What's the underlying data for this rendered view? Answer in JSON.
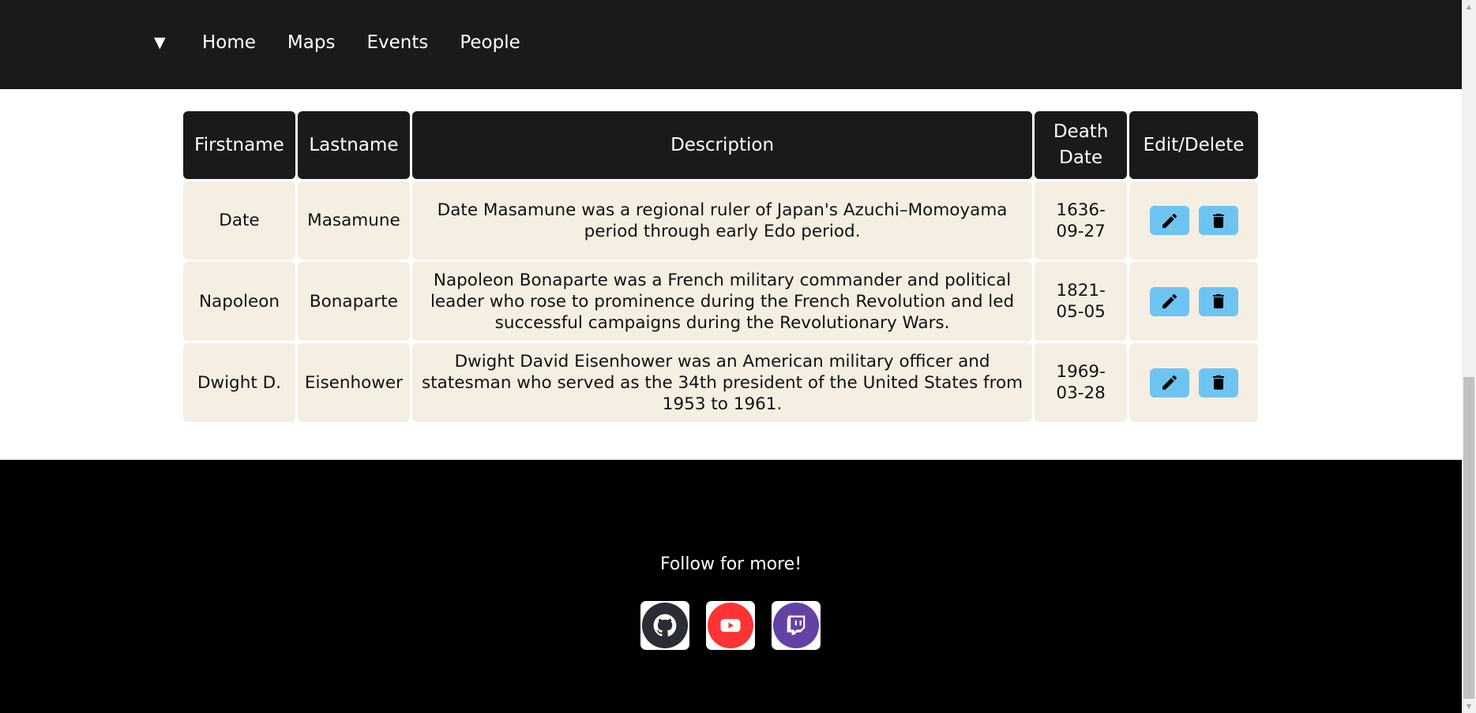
{
  "nav": {
    "toggle_glyph": "▼",
    "links": [
      "Home",
      "Maps",
      "Events",
      "People"
    ]
  },
  "table": {
    "headers": {
      "firstname": "Firstname",
      "lastname": "Lastname",
      "description": "Description",
      "death_date_line1": "Death",
      "death_date_line2": "Date",
      "actions": "Edit/Delete"
    },
    "rows": [
      {
        "firstname": "Date",
        "lastname": "Masamune",
        "description": "Date Masamune was a regional ruler of Japan's Azuchi–Momoyama period through early Edo period.",
        "death_date_1": "1636-",
        "death_date_2": "09-27"
      },
      {
        "firstname": "Napoleon",
        "lastname": "Bonaparte",
        "description": "Napoleon Bonaparte was a French military commander and political leader who rose to prominence during the French Revolution and led successful campaigns during the Revolutionary Wars.",
        "death_date_1": "1821-",
        "death_date_2": "05-05"
      },
      {
        "firstname": "Dwight D.",
        "lastname": "Eisenhower",
        "description": "Dwight David Eisenhower was an American military officer and statesman who served as the 34th president of the United States from 1953 to 1961.",
        "death_date_1": "1969-",
        "death_date_2": "03-28"
      }
    ]
  },
  "footer": {
    "title": "Follow for more!",
    "social": [
      {
        "name": "github",
        "icon": "github-icon",
        "color": "#2a2d33"
      },
      {
        "name": "youtube",
        "icon": "youtube-icon",
        "color": "#ff3333"
      },
      {
        "name": "twitch",
        "icon": "twitch-icon",
        "color": "#6441a4"
      }
    ]
  },
  "colors": {
    "navbar_bg": "#1b1a1a",
    "header_bg": "#1b1a1a",
    "cell_bg": "#f5eee2",
    "action_btn_bg": "#6ec4f1",
    "footer_bg": "#000000"
  }
}
